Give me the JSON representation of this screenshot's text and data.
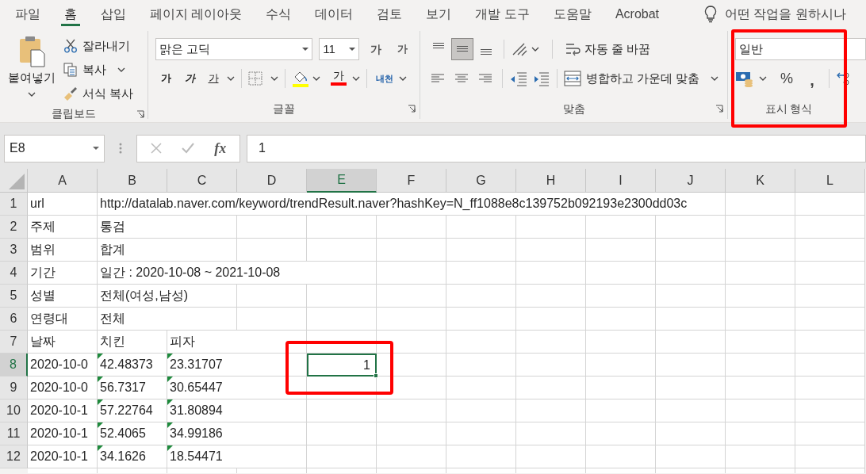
{
  "tabs": [
    {
      "label": "파일",
      "selected": false
    },
    {
      "label": "홈",
      "selected": true
    },
    {
      "label": "삽입",
      "selected": false
    },
    {
      "label": "페이지 레이아웃",
      "selected": false
    },
    {
      "label": "수식",
      "selected": false
    },
    {
      "label": "데이터",
      "selected": false
    },
    {
      "label": "검토",
      "selected": false
    },
    {
      "label": "보기",
      "selected": false
    },
    {
      "label": "개발 도구",
      "selected": false
    },
    {
      "label": "도움말",
      "selected": false
    },
    {
      "label": "Acrobat",
      "selected": false
    }
  ],
  "tell_me": {
    "text": "어떤 작업을 원하시나"
  },
  "ribbon": {
    "clipboard": {
      "label": "클립보드",
      "paste": "붙여넣기",
      "cut": "잘라내기",
      "copy": "복사",
      "format_painter": "서식 복사"
    },
    "font": {
      "label": "글꼴",
      "font_name": "맑은 고딕",
      "font_size": "11",
      "grow": "가",
      "shrink": "가",
      "bold": "가",
      "italic": "가",
      "underline": "가",
      "font_color": "가",
      "phonetic": "내천"
    },
    "alignment": {
      "label": "맞춤",
      "vertical": [
        {
          "kind": "top",
          "selected": false
        },
        {
          "kind": "middle",
          "selected": true
        },
        {
          "kind": "bottom",
          "selected": false
        }
      ],
      "wrap_text": "자동 줄 바꿈",
      "merge_center": "병합하고 가운데 맞춤"
    },
    "number": {
      "label": "표시 형식",
      "format": "일반",
      "percent": "%",
      "comma": ","
    }
  },
  "formula_bar": {
    "name_box": "E8",
    "fx": "fx",
    "value": "1"
  },
  "sheet": {
    "columns": [
      {
        "label": "A",
        "selected": false
      },
      {
        "label": "B",
        "selected": false
      },
      {
        "label": "C",
        "selected": false
      },
      {
        "label": "D",
        "selected": false
      },
      {
        "label": "E",
        "selected": true
      },
      {
        "label": "F",
        "selected": false
      },
      {
        "label": "G",
        "selected": false
      },
      {
        "label": "H",
        "selected": false
      },
      {
        "label": "I",
        "selected": false
      },
      {
        "label": "J",
        "selected": false
      },
      {
        "label": "K",
        "selected": false
      },
      {
        "label": "L",
        "selected": false
      }
    ],
    "rows": [
      {
        "label": "1",
        "selected": false,
        "cells": [
          {
            "kind": "text",
            "text": "url",
            "warning": false,
            "selected": false
          },
          {
            "kind": "text",
            "text": "http://datalab.naver.com/keyword/trendResult.naver?hashKey=N_ff1088e8c139752b092193e2300dd03c",
            "warning": false,
            "selected": false
          }
        ]
      },
      {
        "label": "2",
        "selected": false,
        "cells": [
          {
            "kind": "text",
            "text": "주제",
            "warning": false,
            "selected": false
          },
          {
            "kind": "text",
            "text": "통검",
            "warning": false,
            "selected": false
          }
        ]
      },
      {
        "label": "3",
        "selected": false,
        "cells": [
          {
            "kind": "text",
            "text": "범위",
            "warning": false,
            "selected": false
          },
          {
            "kind": "text",
            "text": "합계",
            "warning": false,
            "selected": false
          }
        ]
      },
      {
        "label": "4",
        "selected": false,
        "cells": [
          {
            "kind": "text",
            "text": "기간",
            "warning": false,
            "selected": false
          },
          {
            "kind": "text",
            "text": "일간 : 2020-10-08 ~ 2021-10-08",
            "warning": false,
            "selected": false
          }
        ]
      },
      {
        "label": "5",
        "selected": false,
        "cells": [
          {
            "kind": "text",
            "text": "성별",
            "warning": false,
            "selected": false
          },
          {
            "kind": "text",
            "text": "전체(여성,남성)",
            "warning": false,
            "selected": false
          }
        ]
      },
      {
        "label": "6",
        "selected": false,
        "cells": [
          {
            "kind": "text",
            "text": "연령대",
            "warning": false,
            "selected": false
          },
          {
            "kind": "text",
            "text": "전체",
            "warning": false,
            "selected": false
          }
        ]
      },
      {
        "label": "7",
        "selected": false,
        "cells": [
          {
            "kind": "text",
            "text": "날짜",
            "warning": false,
            "selected": false
          },
          {
            "kind": "text",
            "text": "치킨",
            "warning": false,
            "selected": false
          },
          {
            "kind": "text",
            "text": "피자",
            "warning": false,
            "selected": false
          }
        ]
      },
      {
        "label": "8",
        "selected": true,
        "cells": [
          {
            "kind": "text",
            "text": "2020-10-0",
            "warning": false,
            "selected": false
          },
          {
            "kind": "text",
            "text": "42.48373",
            "warning": true,
            "selected": false
          },
          {
            "kind": "text",
            "text": "23.31707",
            "warning": true,
            "selected": false
          },
          {
            "kind": "empty"
          },
          {
            "kind": "number",
            "text": "1",
            "warning": false,
            "selected": true
          }
        ]
      },
      {
        "label": "9",
        "selected": false,
        "cells": [
          {
            "kind": "text",
            "text": "2020-10-0",
            "warning": false,
            "selected": false
          },
          {
            "kind": "text",
            "text": "56.7317",
            "warning": true,
            "selected": false
          },
          {
            "kind": "text",
            "text": "30.65447",
            "warning": true,
            "selected": false
          }
        ]
      },
      {
        "label": "10",
        "selected": false,
        "cells": [
          {
            "kind": "text",
            "text": "2020-10-1",
            "warning": false,
            "selected": false
          },
          {
            "kind": "text",
            "text": "57.22764",
            "warning": true,
            "selected": false
          },
          {
            "kind": "text",
            "text": "31.80894",
            "warning": true,
            "selected": false
          }
        ]
      },
      {
        "label": "11",
        "selected": false,
        "cells": [
          {
            "kind": "text",
            "text": "2020-10-1",
            "warning": false,
            "selected": false
          },
          {
            "kind": "text",
            "text": "52.4065",
            "warning": true,
            "selected": false
          },
          {
            "kind": "text",
            "text": "34.99186",
            "warning": true,
            "selected": false
          }
        ]
      },
      {
        "label": "12",
        "selected": false,
        "cells": [
          {
            "kind": "text",
            "text": "2020-10-1",
            "warning": false,
            "selected": false
          },
          {
            "kind": "text",
            "text": "34.1626",
            "warning": true,
            "selected": false
          },
          {
            "kind": "text",
            "text": "18.54471",
            "warning": true,
            "selected": false
          }
        ]
      }
    ]
  }
}
